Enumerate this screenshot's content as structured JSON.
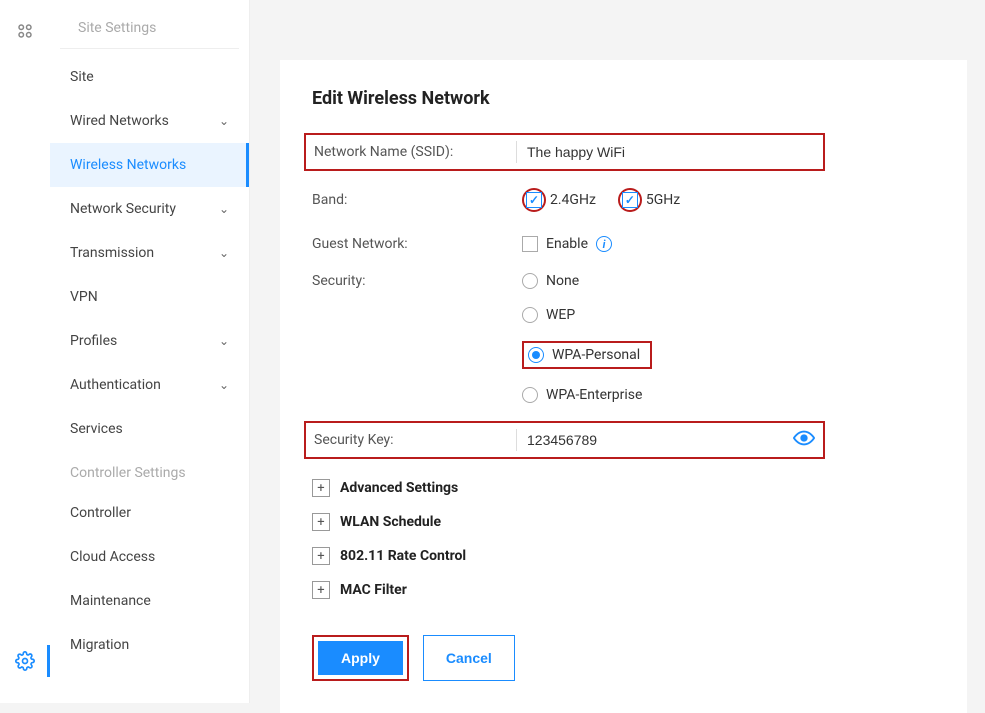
{
  "sidebar": {
    "section1": "Site Settings",
    "section2": "Controller Settings",
    "items1": [
      {
        "label": "Site",
        "expandable": false
      },
      {
        "label": "Wired Networks",
        "expandable": true
      },
      {
        "label": "Wireless Networks",
        "expandable": false,
        "active": true
      },
      {
        "label": "Network Security",
        "expandable": true
      },
      {
        "label": "Transmission",
        "expandable": true
      },
      {
        "label": "VPN",
        "expandable": false
      },
      {
        "label": "Profiles",
        "expandable": true
      },
      {
        "label": "Authentication",
        "expandable": true
      },
      {
        "label": "Services",
        "expandable": false
      }
    ],
    "items2": [
      {
        "label": "Controller"
      },
      {
        "label": "Cloud Access"
      },
      {
        "label": "Maintenance"
      },
      {
        "label": "Migration"
      }
    ]
  },
  "form": {
    "title": "Edit Wireless Network",
    "ssid_label": "Network Name (SSID):",
    "ssid_value": "The happy WiFi",
    "band_label": "Band:",
    "band_24": "2.4GHz",
    "band_5": "5GHz",
    "guest_label": "Guest Network:",
    "guest_enable": "Enable",
    "security_label": "Security:",
    "sec_none": "None",
    "sec_wep": "WEP",
    "sec_wpa_p": "WPA-Personal",
    "sec_wpa_e": "WPA-Enterprise",
    "key_label": "Security Key:",
    "key_value": "123456789",
    "exp_advanced": "Advanced Settings",
    "exp_wlan": "WLAN Schedule",
    "exp_rate": "802.11 Rate Control",
    "exp_mac": "MAC Filter",
    "apply": "Apply",
    "cancel": "Cancel"
  }
}
